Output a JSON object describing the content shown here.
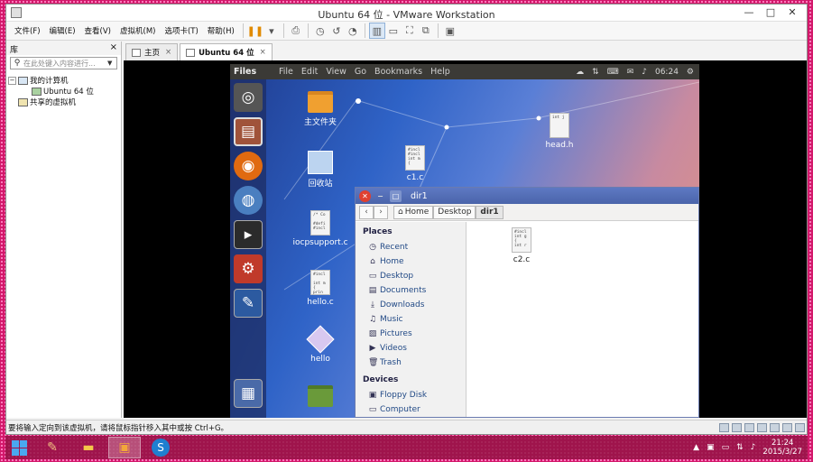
{
  "window": {
    "title": "Ubuntu 64 位 - VMware Workstation",
    "minimize": "—",
    "maximize": "□",
    "close": "✕"
  },
  "menu": [
    "文件(F)",
    "编辑(E)",
    "查看(V)",
    "虚拟机(M)",
    "选项卡(T)",
    "帮助(H)"
  ],
  "library": {
    "title": "库",
    "close": "×",
    "search_placeholder": "在此处键入内容进行...",
    "tree": {
      "root": "我的计算机",
      "vm": "Ubuntu 64 位",
      "shared": "共享的虚拟机"
    }
  },
  "tabs": [
    {
      "label": "主页",
      "close": "×"
    },
    {
      "label": "Ubuntu 64 位",
      "close": "×"
    }
  ],
  "guest": {
    "panel": {
      "app": "Files",
      "menus": [
        "File",
        "Edit",
        "View",
        "Go",
        "Bookmarks",
        "Help"
      ],
      "time": "06:24"
    },
    "desktop_icons": {
      "home_folder": "主文件夹",
      "trash": "回收站",
      "c1": "c1.c",
      "iocp": "iocpsupport.c",
      "hello_c": "hello.c",
      "hello": "hello",
      "head": "head.h"
    },
    "file_snippets": {
      "c1": "#incl\n#incl\nint m\n{",
      "iocp": "/* Co\n\n#defi\n#incl",
      "hello_c": "#incl\n\nint m\n{\nprin",
      "head": "int j\n\n",
      "c2": "#incl\nint g\n{\nint r"
    },
    "nautilus": {
      "title": "dir1",
      "back": "‹",
      "forward": "›",
      "breadcrumbs": [
        "Home",
        "Desktop",
        "dir1"
      ],
      "places_heading": "Places",
      "places": [
        "Recent",
        "Home",
        "Desktop",
        "Documents",
        "Downloads",
        "Music",
        "Pictures",
        "Videos",
        "Trash"
      ],
      "devices_heading": "Devices",
      "devices": [
        "Floppy Disk",
        "Computer"
      ],
      "files": [
        "c2.c"
      ]
    }
  },
  "status": {
    "message": "要将输入定向到该虚拟机，请将鼠标指针移入其中或按 Ctrl+G。"
  },
  "taskbar": {
    "time": "21:24",
    "date": "2015/3/27"
  },
  "colors": {
    "frame": "#d2186a",
    "guest_panel": "#3b3a36",
    "nautilus_title": "#4a64aa"
  }
}
